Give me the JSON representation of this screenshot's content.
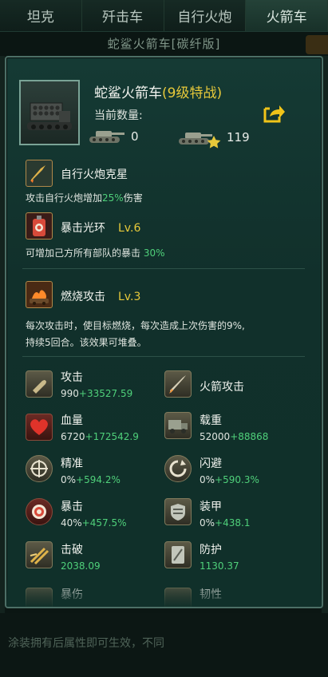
{
  "tabs": [
    "坦克",
    "歼击车",
    "自行火炮",
    "火箭车"
  ],
  "active_tab_index": 3,
  "background": {
    "subtitle": "蛇鲨火箭车[碳纤版]",
    "bottom_text": "涂装拥有后属性即可生效，不同"
  },
  "unit": {
    "name": "蛇鲨火箭车",
    "grade": "(9级特战)",
    "count_label": "当前数量:",
    "count_normal": "0",
    "count_elite": "119"
  },
  "skills": [
    {
      "icon": "rocket-shell-icon",
      "title": "自行火炮克星",
      "level": "",
      "desc_pre": "攻击自行火炮增加",
      "desc_hl": "25%",
      "desc_post": "伤害"
    },
    {
      "icon": "target-bag-icon",
      "title": "暴击光环",
      "level": "Lv.6",
      "desc_pre": "可增加己方所有部队的暴击 ",
      "desc_hl": "30%",
      "desc_post": ""
    },
    {
      "icon": "burn-vehicle-icon",
      "title": "燃烧攻击",
      "level": "Lv.3",
      "desc_line1": "每次攻击时，使目标燃烧，每次造成上次伤害的9%,",
      "desc_line2": "持续5回合。该效果可堆叠。"
    }
  ],
  "stats": [
    {
      "icon": "bullet-icon",
      "name": "攻击",
      "base": "990",
      "bonus": "+33527.59"
    },
    {
      "icon": "rocket-icon",
      "name": "火箭攻击",
      "base": "",
      "bonus": ""
    },
    {
      "icon": "heart-icon",
      "name": "血量",
      "base": "6720",
      "bonus": "+172542.9"
    },
    {
      "icon": "truck-icon",
      "name": "载重",
      "base": "52000",
      "bonus": "+88868"
    },
    {
      "icon": "crosshair-icon",
      "name": "精准",
      "base": "0%",
      "bonus": "+594.2%"
    },
    {
      "icon": "dodge-icon",
      "name": "闪避",
      "base": "0%",
      "bonus": "+590.3%"
    },
    {
      "icon": "crit-target-icon",
      "name": "暴击",
      "base": "40%",
      "bonus": "+457.5%"
    },
    {
      "icon": "armor-icon",
      "name": "装甲",
      "base": "0%",
      "bonus": "+438.1"
    },
    {
      "icon": "pierce-icon",
      "name": "击破",
      "base": "",
      "bonus": "2038.09"
    },
    {
      "icon": "shield-icon",
      "name": "防护",
      "base": "",
      "bonus": "1130.37"
    },
    {
      "icon": "crit-damage-icon",
      "name": "暴伤",
      "base": "",
      "bonus": ""
    },
    {
      "icon": "toughness-icon",
      "name": "韧性",
      "base": "",
      "bonus": ""
    }
  ]
}
